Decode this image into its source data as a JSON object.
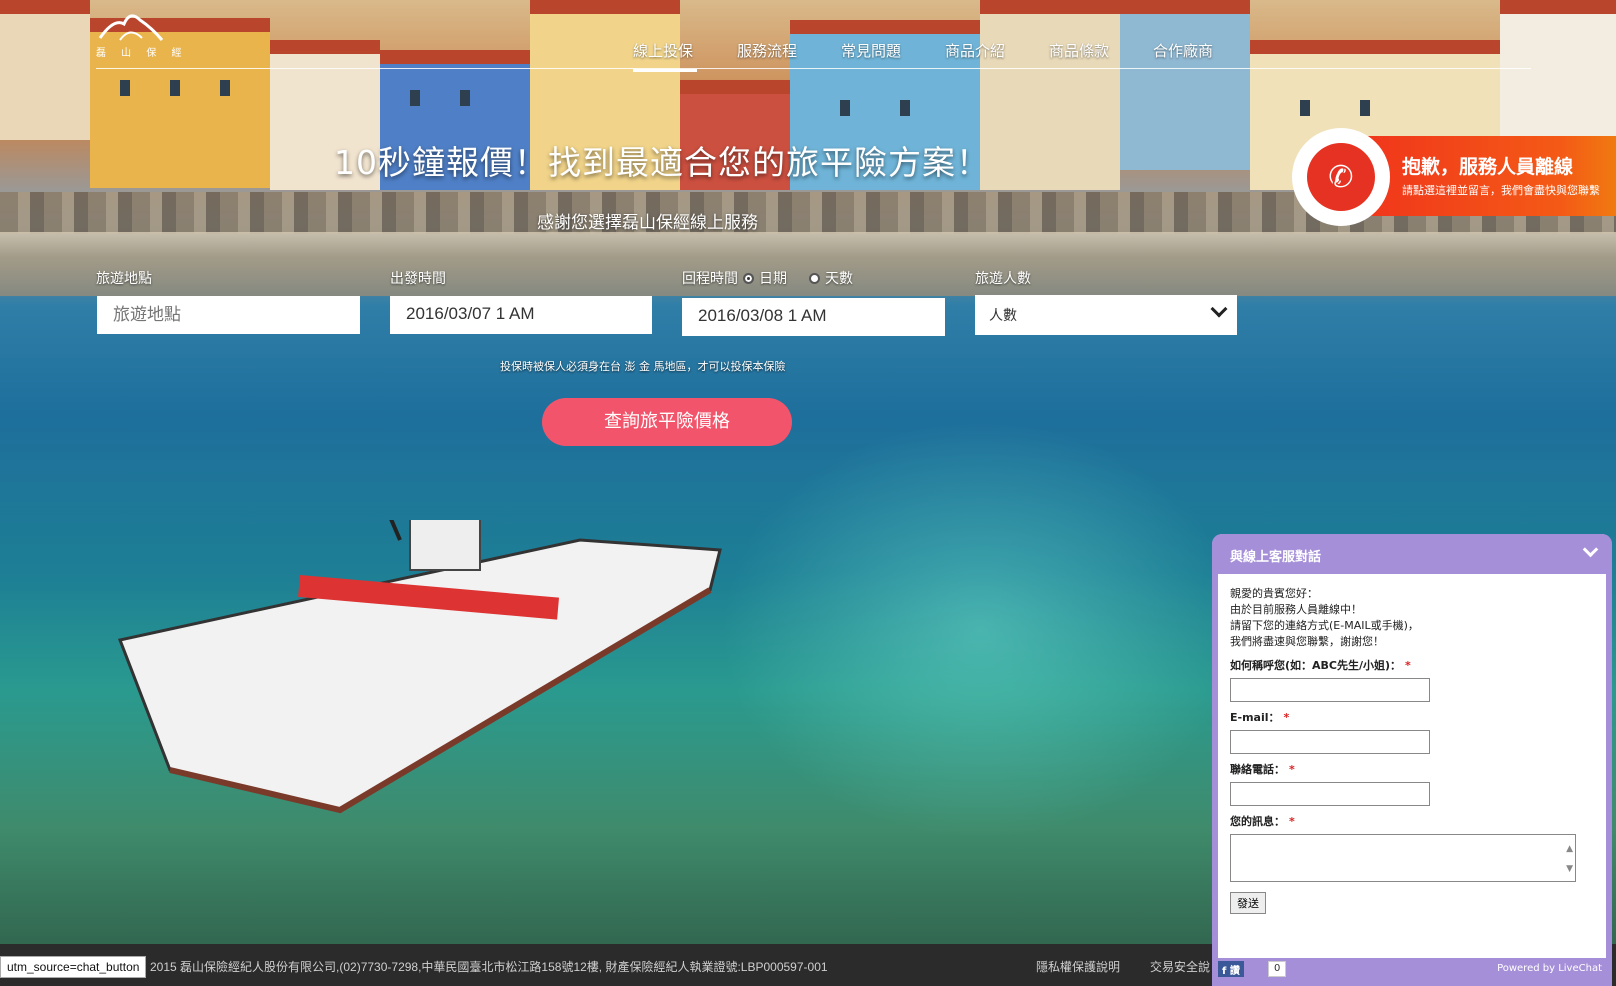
{
  "header": {
    "logo_text": "磊 山 保 經",
    "nav": [
      {
        "label": "線上投保",
        "active": true
      },
      {
        "label": "服務流程"
      },
      {
        "label": "常見問題"
      },
      {
        "label": "商品介紹"
      },
      {
        "label": "商品條款"
      },
      {
        "label": "合作廠商"
      }
    ]
  },
  "hero": {
    "title": "10秒鐘報價！找到最適合您的旅平險方案！",
    "subtitle": "感謝您選擇磊山保經線上服務"
  },
  "form": {
    "destination": {
      "label": "旅遊地點",
      "placeholder": "旅遊地點"
    },
    "depart": {
      "label": "出發時間",
      "value": "2016/03/07 1 AM"
    },
    "return": {
      "label": "回程時間",
      "option_date": "日期",
      "option_days": "天數",
      "value": "2016/03/08 1 AM",
      "selected": "日期"
    },
    "people": {
      "label": "旅遊人數",
      "value": "人數"
    },
    "notice": "投保時被保人必須身在台 澎 金 馬地區，才可以投保本保險",
    "submit": "查詢旅平險價格"
  },
  "offline_badge": {
    "title": "抱歉，服務人員離線",
    "desc": "請點選這裡並留言，我們會盡快與您聯繫",
    "icon": "phone-icon",
    "color": "#f0321c"
  },
  "chat": {
    "title": "與線上客服對話",
    "intro": [
      "親愛的貴賓您好：",
      "由於目前服務人員離線中！",
      "請留下您的連絡方式(E-MAIL或手機)，",
      "我們將盡速與您聯繫，謝謝您！"
    ],
    "name_label": "如何稱呼您(如：ABC先生/小姐)：",
    "email_label": "E-mail：",
    "phone_label": "聯絡電話：",
    "message_label": "您的訊息：",
    "required_mark": "*",
    "send": "發送",
    "fb_label": "讚",
    "fb_count": "0",
    "powered": "Powered by LiveChat",
    "accent": "#a58fd8"
  },
  "footer": {
    "copyright": "2015 磊山保險經紀人股份有限公司,(02)7730-7298,中華民國臺北市松江路158號12樓, 財產保險經紀人執業證號:LBP000597-001",
    "privacy": "隱私權保護說明",
    "trade": "交易安全說"
  },
  "status_bar": "utm_source=chat_button",
  "accent_colors": {
    "button": "#f2556b"
  }
}
